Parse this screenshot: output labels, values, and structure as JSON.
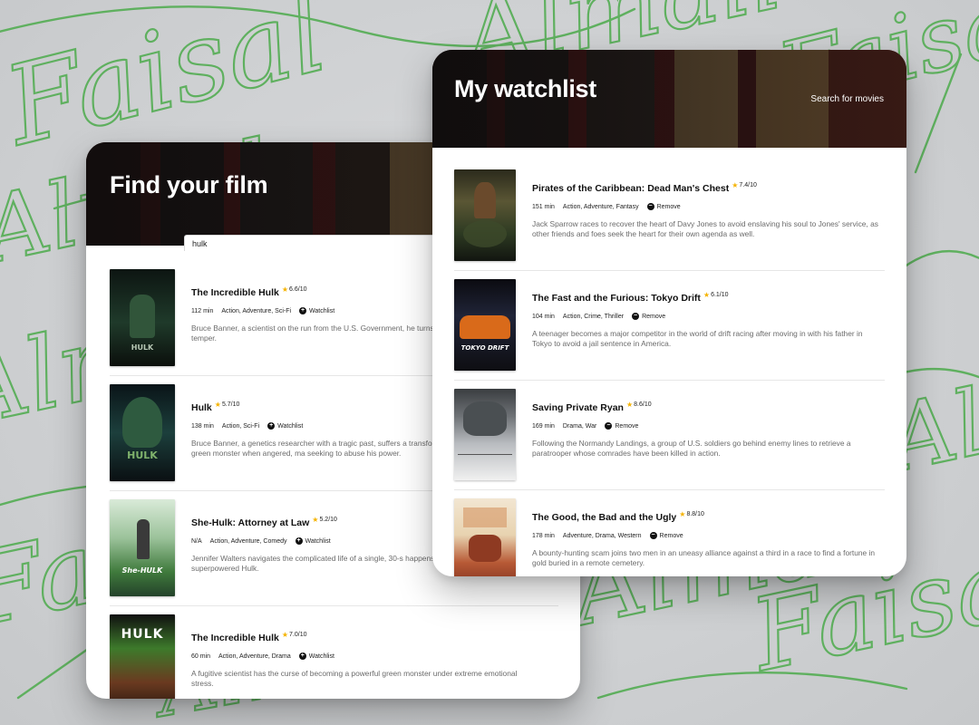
{
  "background": {
    "script_words": [
      "Faisal",
      "Almail"
    ],
    "accent_color": "#5fb05f"
  },
  "find_panel": {
    "title": "Find your film",
    "search": {
      "value": "hulk",
      "placeholder": ""
    },
    "films": [
      {
        "title": "The Incredible Hulk",
        "rating": "6.6/10",
        "runtime": "112 min",
        "genres": "Action, Adventure, Sci-Fi",
        "action_label": "Watchlist",
        "description": "Bruce Banner, a scientist on the run from the U.S. Government, he turns into whenever he loses his temper.",
        "poster_text": "HULK"
      },
      {
        "title": "Hulk",
        "rating": "5.7/10",
        "runtime": "138 min",
        "genres": "Action, Sci-Fi",
        "action_label": "Watchlist",
        "description": "Bruce Banner, a genetics researcher with a tragic past, suffers a transform into a raging, giant green monster when angered, ma seeking to abuse his power.",
        "poster_text": "HULK"
      },
      {
        "title": "She-Hulk: Attorney at Law",
        "rating": "5.2/10",
        "runtime": "N/A",
        "genres": "Action, Adventure, Comedy",
        "action_label": "Watchlist",
        "description": "Jennifer Walters navigates the complicated life of a single, 30-s happens to be a green 6-foot-7-inch superpowered Hulk.",
        "poster_text": "She-HULK"
      },
      {
        "title": "The Incredible Hulk",
        "rating": "7.0/10",
        "runtime": "60 min",
        "genres": "Action, Adventure, Drama",
        "action_label": "Watchlist",
        "description": "A fugitive scientist has the curse of becoming a powerful green monster under extreme emotional stress.",
        "poster_text": "HULK"
      }
    ]
  },
  "watch_panel": {
    "title": "My watchlist",
    "search_link": "Search for movies",
    "films": [
      {
        "title": "Pirates of the Caribbean: Dead Man's Chest",
        "rating": "7.4/10",
        "runtime": "151 min",
        "genres": "Action, Adventure, Fantasy",
        "action_label": "Remove",
        "description": "Jack Sparrow races to recover the heart of Davy Jones to avoid enslaving his soul to Jones' service, as other friends and foes seek the heart for their own agenda as well."
      },
      {
        "title": "The Fast and the Furious: Tokyo Drift",
        "rating": "6.1/10",
        "runtime": "104 min",
        "genres": "Action, Crime, Thriller",
        "action_label": "Remove",
        "description": "A teenager becomes a major competitor in the world of drift racing after moving in with his father in Tokyo to avoid a jail sentence in America.",
        "poster_text": "TOKYO DRIFT"
      },
      {
        "title": "Saving Private Ryan",
        "rating": "8.6/10",
        "runtime": "169 min",
        "genres": "Drama, War",
        "action_label": "Remove",
        "description": "Following the Normandy Landings, a group of U.S. soldiers go behind enemy lines to retrieve a paratrooper whose comrades have been killed in action."
      },
      {
        "title": "The Good, the Bad and the Ugly",
        "rating": "8.8/10",
        "runtime": "178 min",
        "genres": "Adventure, Drama, Western",
        "action_label": "Remove",
        "description": "A bounty-hunting scam joins two men in an uneasy alliance against a third in a race to find a fortune in gold buried in a remote cemetery."
      }
    ]
  },
  "icons": {
    "add": "plus-circle-icon",
    "remove": "minus-circle-icon",
    "rating": "star-icon"
  }
}
